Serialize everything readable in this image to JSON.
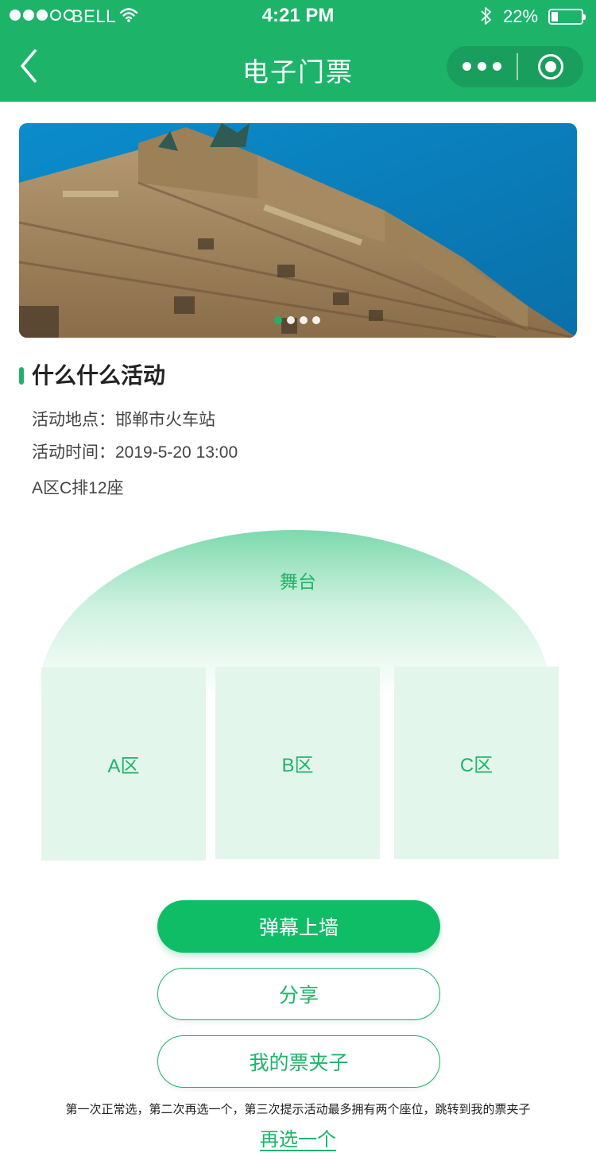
{
  "status_bar": {
    "carrier": "BELL",
    "time": "4:21 PM",
    "battery_percent": "22%",
    "battery_level": 0.22,
    "signal_full_dots": 3,
    "signal_total_dots": 5
  },
  "nav": {
    "title": "电子门票",
    "back_icon": "chevron-left-icon",
    "more_icon": "more-dots-icon",
    "close_icon": "target-circle-icon"
  },
  "banner": {
    "image": "baroque-theatre-facade-photo",
    "slides": 4,
    "active_slide": 1
  },
  "event": {
    "title": "什么什么活动",
    "location": "活动地点：邯郸市火车站",
    "time": "活动时间：2019-5-20 13:00",
    "seat": "A区C排12座"
  },
  "stage": {
    "label": "舞台"
  },
  "zones": [
    {
      "label": "A区"
    },
    {
      "label": "B区"
    },
    {
      "label": "C区"
    }
  ],
  "actions": {
    "danmaku": "弹幕上墙",
    "share": "分享",
    "my_tickets": "我的票夹子"
  },
  "hint": "第一次正常选，第二次再选一个，第三次提示活动最多拥有两个座位，跳转到我的票夹子",
  "reselect": "再选一个",
  "colors": {
    "brand_green": "#1db46a",
    "button_green": "#0fbd67",
    "zone_bg": "#e3f6ec"
  }
}
